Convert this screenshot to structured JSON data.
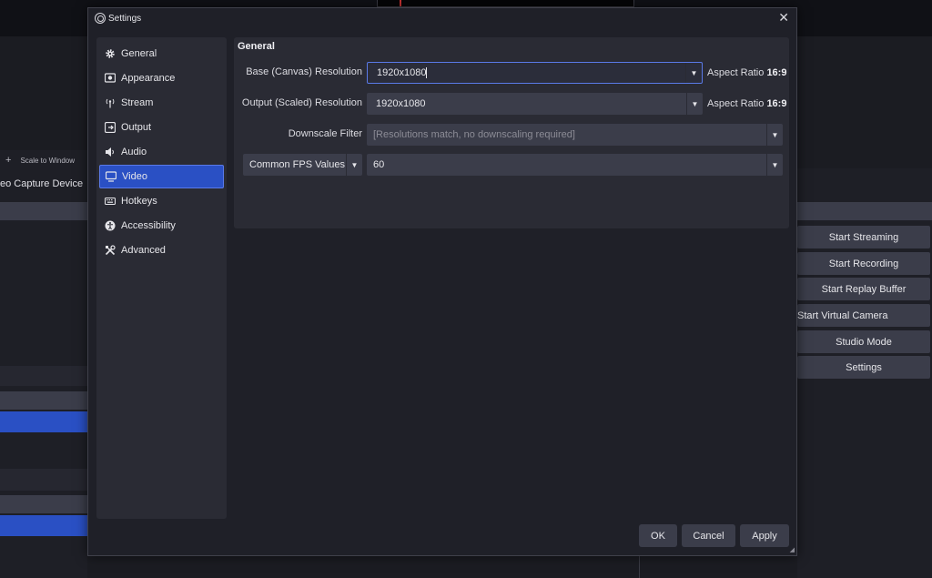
{
  "background": {
    "toolbar": {
      "add_symbol": "+",
      "scale_label": "Scale to Window"
    },
    "source_label": "eo Capture Device",
    "controls": [
      "Start Streaming",
      "Start Recording",
      "Start Replay Buffer",
      "Start Virtual Camera",
      "Studio Mode",
      "Settings"
    ]
  },
  "dialog": {
    "title": "Settings",
    "close_symbol": "✕",
    "nav": [
      {
        "label": "General",
        "icon": "gear-icon"
      },
      {
        "label": "Appearance",
        "icon": "appearance-icon"
      },
      {
        "label": "Stream",
        "icon": "antenna-icon"
      },
      {
        "label": "Output",
        "icon": "output-icon"
      },
      {
        "label": "Audio",
        "icon": "speaker-icon"
      },
      {
        "label": "Video",
        "icon": "monitor-icon",
        "active": true
      },
      {
        "label": "Hotkeys",
        "icon": "keyboard-icon"
      },
      {
        "label": "Accessibility",
        "icon": "accessibility-icon"
      },
      {
        "label": "Advanced",
        "icon": "tools-icon"
      }
    ],
    "section_title": "General",
    "fields": {
      "base_label": "Base (Canvas) Resolution",
      "base_value": "1920x1080",
      "base_aspect_label": "Aspect Ratio",
      "base_aspect_value": "16:9",
      "output_label": "Output (Scaled) Resolution",
      "output_value": "1920x1080",
      "output_aspect_label": "Aspect Ratio",
      "output_aspect_value": "16:9",
      "downscale_label": "Downscale Filter",
      "downscale_value": "[Resolutions match, no downscaling required]",
      "fps_type": "Common FPS Values",
      "fps_value": "60"
    },
    "buttons": {
      "ok": "OK",
      "cancel": "Cancel",
      "apply": "Apply"
    }
  },
  "colors": {
    "accent": "#2a50c4",
    "accent_border": "#5a7ae8",
    "panel": "#2a2b34",
    "button": "#3b3d4a"
  }
}
